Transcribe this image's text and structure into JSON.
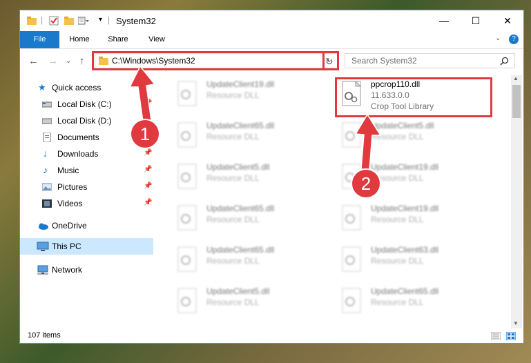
{
  "window": {
    "title": "System32"
  },
  "window_controls": {
    "minimize": "—",
    "maximize": "☐",
    "close": "✕"
  },
  "ribbon": {
    "tabs": [
      "File",
      "Home",
      "Share",
      "View"
    ]
  },
  "address": {
    "path": "C:\\Windows\\System32",
    "search_placeholder": "Search System32"
  },
  "nav": {
    "items": [
      {
        "label": "Quick access",
        "icon": "star-icon"
      },
      {
        "label": "Local Disk (C:)",
        "icon": "drive-icon",
        "pinned": true
      },
      {
        "label": "Local Disk (D:)",
        "icon": "drive-icon"
      },
      {
        "label": "Documents",
        "icon": "documents-icon",
        "pinned": true
      },
      {
        "label": "Downloads",
        "icon": "download-icon",
        "pinned": true
      },
      {
        "label": "Music",
        "icon": "music-icon",
        "pinned": true
      },
      {
        "label": "Pictures",
        "icon": "pictures-icon",
        "pinned": true
      },
      {
        "label": "Videos",
        "icon": "videos-icon",
        "pinned": true
      },
      {
        "label": "OneDrive",
        "icon": "cloud-icon"
      },
      {
        "label": "This PC",
        "icon": "computer-icon",
        "selected": true
      },
      {
        "label": "Network",
        "icon": "network-icon"
      }
    ]
  },
  "files": {
    "highlight": {
      "name": "ppcrop110.dll",
      "version": "11.633.0.0",
      "description": "Crop Tool Library"
    },
    "left_column": [
      {
        "name": "UpdateClient19.dll",
        "type": "Resource DLL"
      },
      {
        "name": "UpdateClient65.dll",
        "type": "Resource DLL"
      },
      {
        "name": "UpdateClient5.dll",
        "type": "Resource DLL"
      },
      {
        "name": "UpdateClient65.dll",
        "type": "Resource DLL"
      },
      {
        "name": "UpdateClient65.dll",
        "type": "Resource DLL"
      },
      {
        "name": "UpdateClient5.dll",
        "type": "Resource DLL"
      }
    ],
    "right_column": [
      {
        "name": "UpdateClient5.dll",
        "type": "Resource DLL"
      },
      {
        "name": "UpdateClient19.dll",
        "type": "Resource DLL"
      },
      {
        "name": "UpdateClient19.dll",
        "type": "Resource DLL"
      },
      {
        "name": "UpdateClient63.dll",
        "type": "Resource DLL"
      },
      {
        "name": "UpdateClient65.dll",
        "type": "Resource DLL"
      }
    ]
  },
  "status": {
    "item_count": "107 items"
  },
  "callouts": {
    "one": "1",
    "two": "2"
  },
  "colors": {
    "accent": "#1979ca",
    "highlight_red": "#e0393e",
    "selected_bg": "#cce8ff"
  }
}
